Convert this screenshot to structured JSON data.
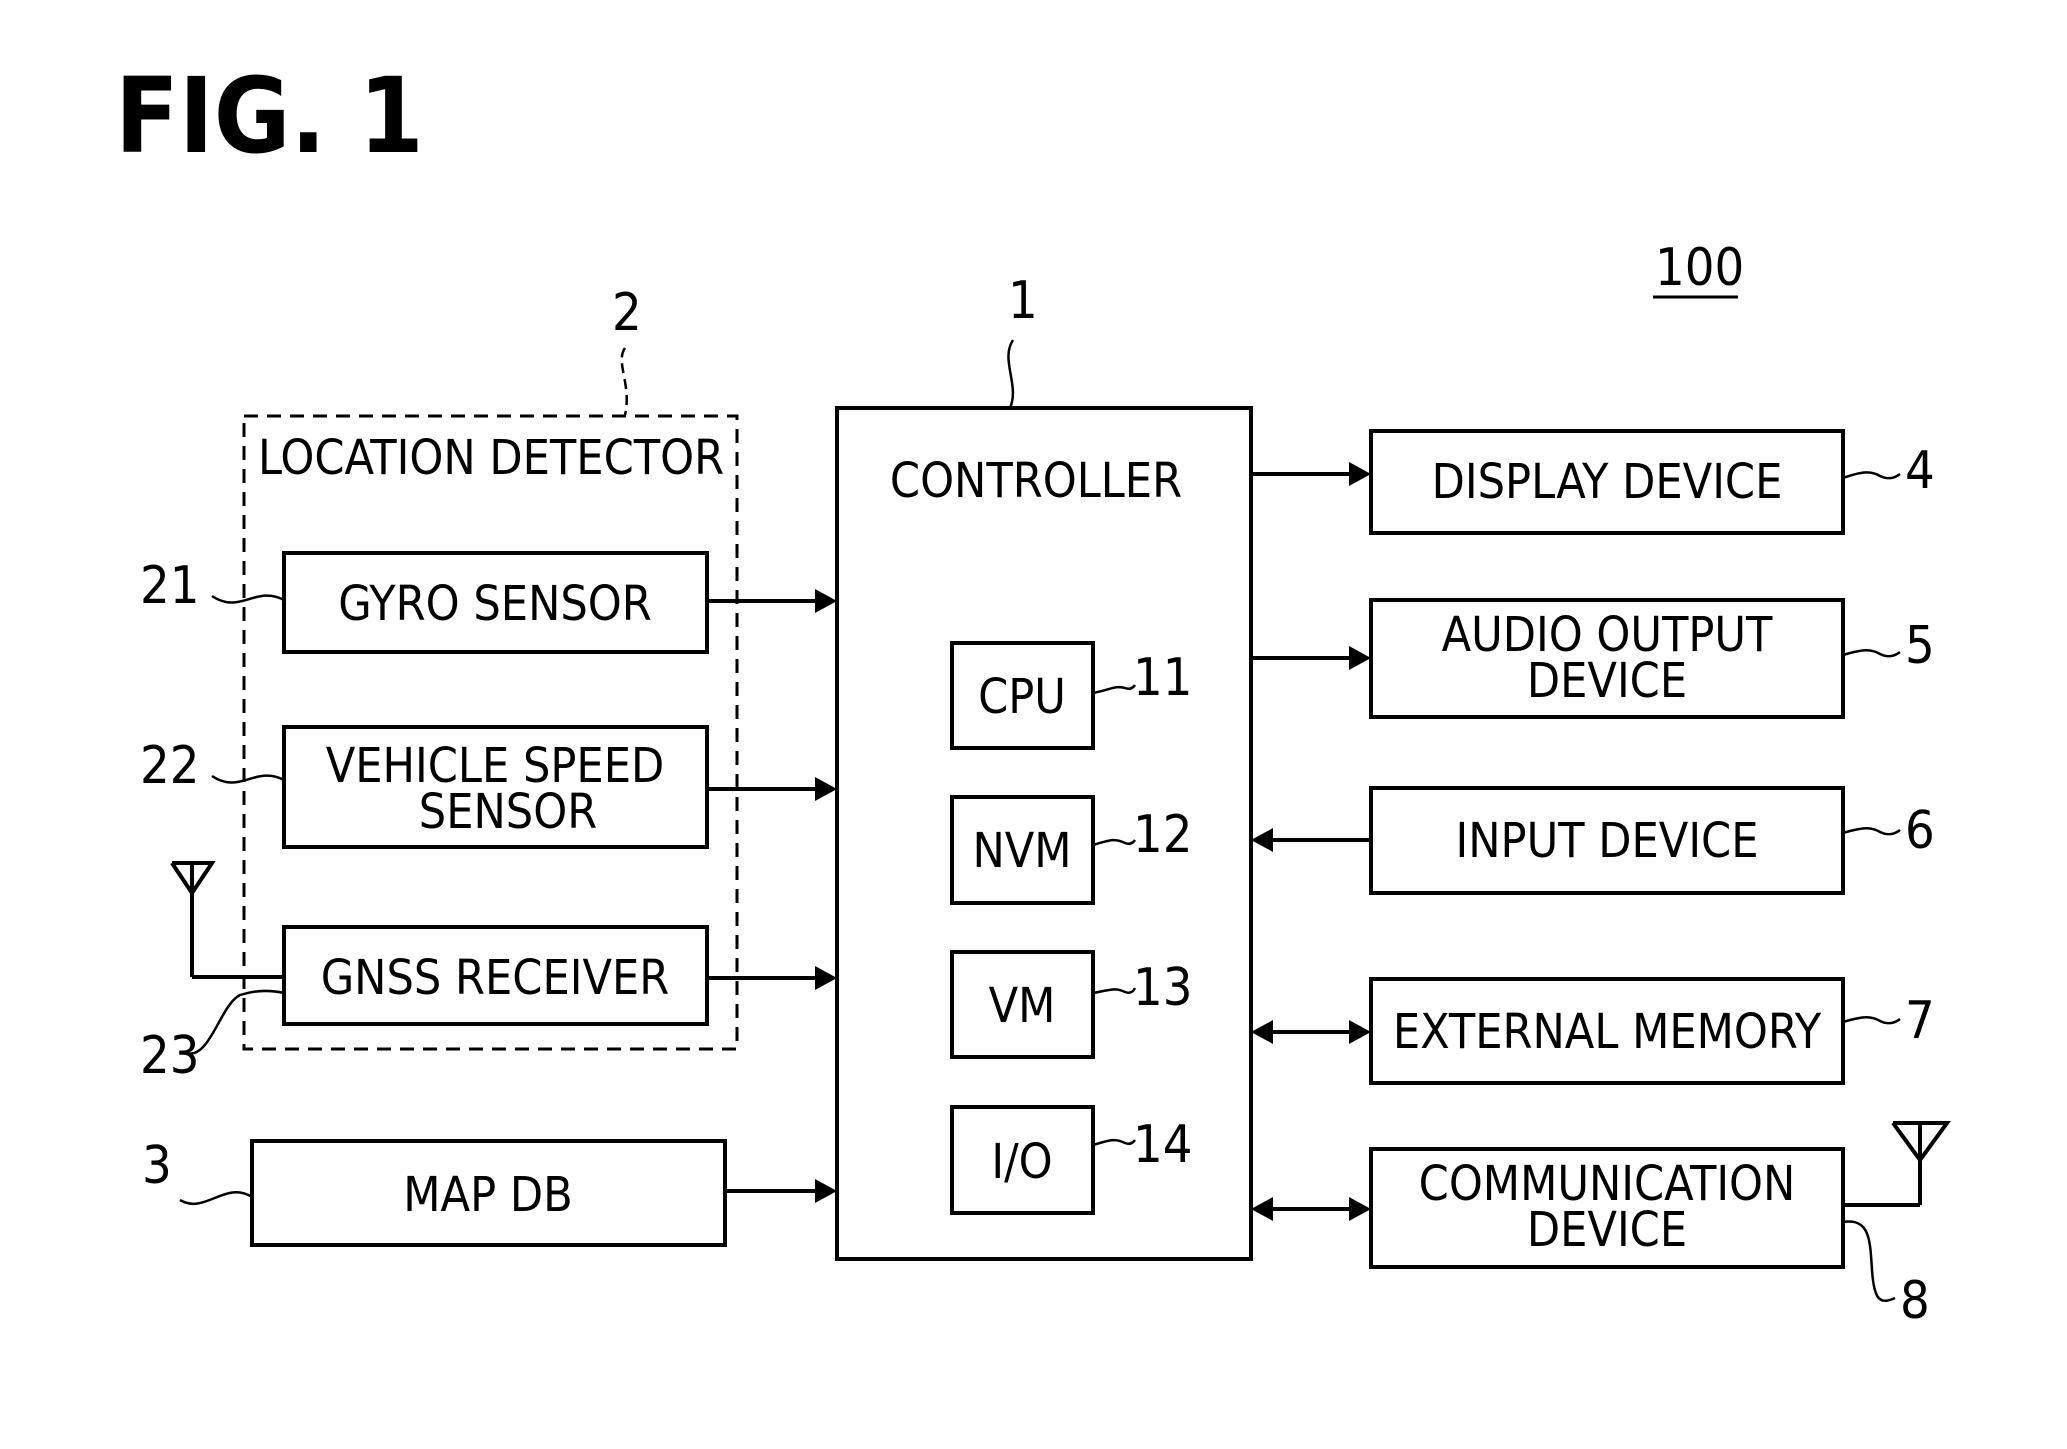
{
  "figure": {
    "title": "FIG. 1",
    "system_ref": "100"
  },
  "location_detector": {
    "ref": "2",
    "label": "LOCATION DETECTOR",
    "gyro": {
      "ref": "21",
      "label": "GYRO SENSOR"
    },
    "speed": {
      "ref": "22",
      "label_line1": "VEHICLE SPEED",
      "label_line2": "SENSOR"
    },
    "gnss": {
      "ref": "23",
      "label": "GNSS RECEIVER"
    }
  },
  "map_db": {
    "ref": "3",
    "label": "MAP DB"
  },
  "controller": {
    "ref": "1",
    "label": "CONTROLLER",
    "cpu": {
      "ref": "11",
      "label": "CPU"
    },
    "nvm": {
      "ref": "12",
      "label": "NVM"
    },
    "vm": {
      "ref": "13",
      "label": "VM"
    },
    "io": {
      "ref": "14",
      "label": "I/O"
    }
  },
  "display": {
    "ref": "4",
    "label": "DISPLAY DEVICE"
  },
  "audio": {
    "ref": "5",
    "label_line1": "AUDIO OUTPUT",
    "label_line2": "DEVICE"
  },
  "input": {
    "ref": "6",
    "label": "INPUT DEVICE"
  },
  "external_memory": {
    "ref": "7",
    "label": "EXTERNAL MEMORY"
  },
  "communication": {
    "ref": "8",
    "label_line1": "COMMUNICATION",
    "label_line2": "DEVICE"
  },
  "connections": [
    {
      "from": "GYRO SENSOR",
      "to": "CONTROLLER",
      "direction": "one-way"
    },
    {
      "from": "VEHICLE SPEED SENSOR",
      "to": "CONTROLLER",
      "direction": "one-way"
    },
    {
      "from": "GNSS RECEIVER",
      "to": "CONTROLLER",
      "direction": "one-way"
    },
    {
      "from": "MAP DB",
      "to": "CONTROLLER",
      "direction": "one-way"
    },
    {
      "from": "CONTROLLER",
      "to": "DISPLAY DEVICE",
      "direction": "one-way"
    },
    {
      "from": "CONTROLLER",
      "to": "AUDIO OUTPUT DEVICE",
      "direction": "one-way"
    },
    {
      "from": "INPUT DEVICE",
      "to": "CONTROLLER",
      "direction": "one-way"
    },
    {
      "from": "CONTROLLER",
      "to": "EXTERNAL MEMORY",
      "direction": "two-way"
    },
    {
      "from": "CONTROLLER",
      "to": "COMMUNICATION DEVICE",
      "direction": "two-way"
    }
  ]
}
